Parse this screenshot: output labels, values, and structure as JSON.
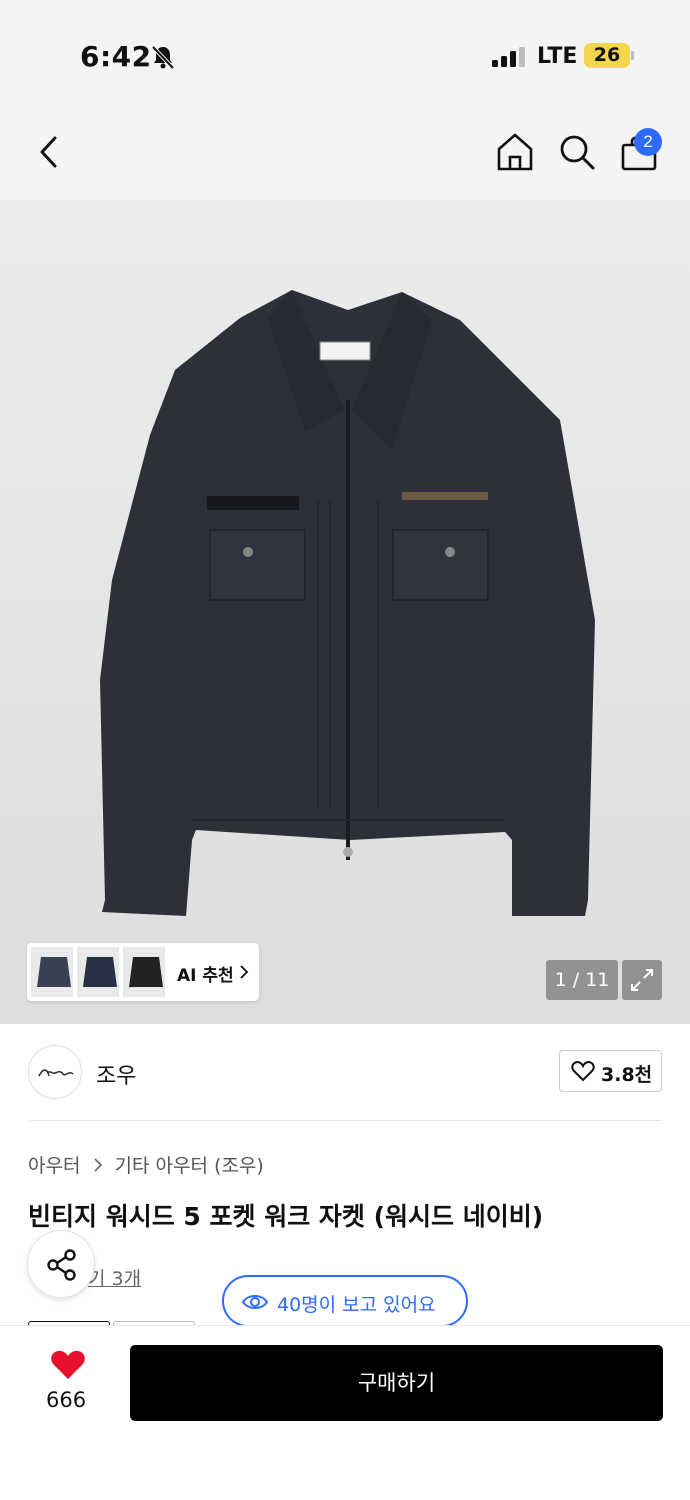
{
  "status_bar": {
    "time": "6:42",
    "network": "LTE",
    "battery": "26"
  },
  "nav": {
    "cart_count": "2"
  },
  "gallery": {
    "ai_label": "AI 추천",
    "counter": "1 / 11"
  },
  "brand": {
    "name": "조우",
    "likes": "3.8천"
  },
  "breadcrumb": {
    "category": "아우터",
    "subcategory": "기타 아우터 (조우)"
  },
  "product": {
    "title": "빈티지 워시드 5 포켓 워크 자켓 (워시드 네이비)",
    "review_text": "기 3개"
  },
  "viewers": {
    "text": "40명이 보고 있어요"
  },
  "bottom": {
    "wish_count": "666",
    "buy_label": "구매하기"
  },
  "colors": {
    "accent": "#2f6bff",
    "heart": "#e8112d",
    "buy": "#000000",
    "jacket": "#2d3039"
  }
}
